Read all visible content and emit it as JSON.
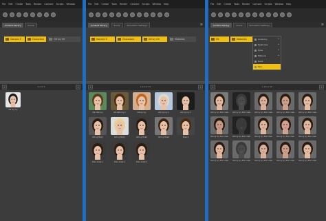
{
  "menu_items": [
    "File",
    "Edit",
    "Create",
    "Tools",
    "Render",
    "Connect",
    "Scripts",
    "Window",
    "Help"
  ],
  "workspace_label": "Surfacing | Rendering",
  "tabs": [
    "Content Library",
    "Scene",
    "Simulation Settings"
  ],
  "panels": [
    {
      "breadcrumb": [
        "Genesis 9",
        "Characters",
        "G9 Ivy G9"
      ],
      "pager": "1-1 of 1",
      "items": [
        "G9 Ivy Ivy"
      ]
    },
    {
      "breadcrumb": [
        "Genesis 9",
        "Characters",
        "G9 Ivy G9",
        "Materials"
      ],
      "pager": "1-13 of 13",
      "items": [
        "G9 Cats Ivy",
        "G9 Cats Ivy 2",
        "G9 Ivy Ivy",
        "G9 Ivy Ivy 2",
        "G9 Ivy Ivy 3",
        "G9 Ivy Body",
        "G9 Ivy Body",
        "G9 Ivy Head",
        "G9 Ivy Head",
        "Pose 0",
        "Pose smile 1",
        "Pose smile 2",
        "Pose smile 3"
      ]
    },
    {
      "breadcrumb": [
        "G9",
        "Materials"
      ],
      "pager": "1-15 of 15",
      "dropdown": [
        {
          "label": "Anatomy",
          "arrow": true
        },
        {
          "label": "Eyebrows",
          "arrow": true
        },
        {
          "label": "Eyes",
          "arrow": true
        },
        {
          "label": "Makeup",
          "arrow": true
        },
        {
          "label": "Nails",
          "arrow": false
        },
        {
          "label": "Skin",
          "arrow": false
        }
      ],
      "items": [
        "G9 Ivy Ivy Skin materials",
        "G9 Ivy Ivy Skin materials",
        "G9 Ivy Ivy Skin materials",
        "G9 Ivy Ivy Skin materials",
        "G9 Ivy Ivy Skin materials",
        "G9 Ivy Ivy Skin materials",
        "G9 Ivy Ivy Skin materials",
        "G9 Ivy Ivy Skin materials",
        "G9 Ivy Ivy Skin materials",
        "G9 Ivy Ivy Skin materials",
        "G9 Ivy Ivy Skin materials",
        "G9 Ivy Ivy Skin materials",
        "G9 Ivy Ivy Skin materials",
        "G9 Ivy Ivy Skin materials",
        "G9 Ivy Ivy Skin materials"
      ]
    }
  ],
  "icons": [
    "folder-icon",
    "refresh-icon",
    "settings-icon",
    "prev-page-icon",
    "next-page-icon",
    "menu-icon"
  ],
  "colors": {
    "accent": "#f0c010",
    "divider": "#1f6ec2",
    "panel": "#3c3c3c"
  }
}
